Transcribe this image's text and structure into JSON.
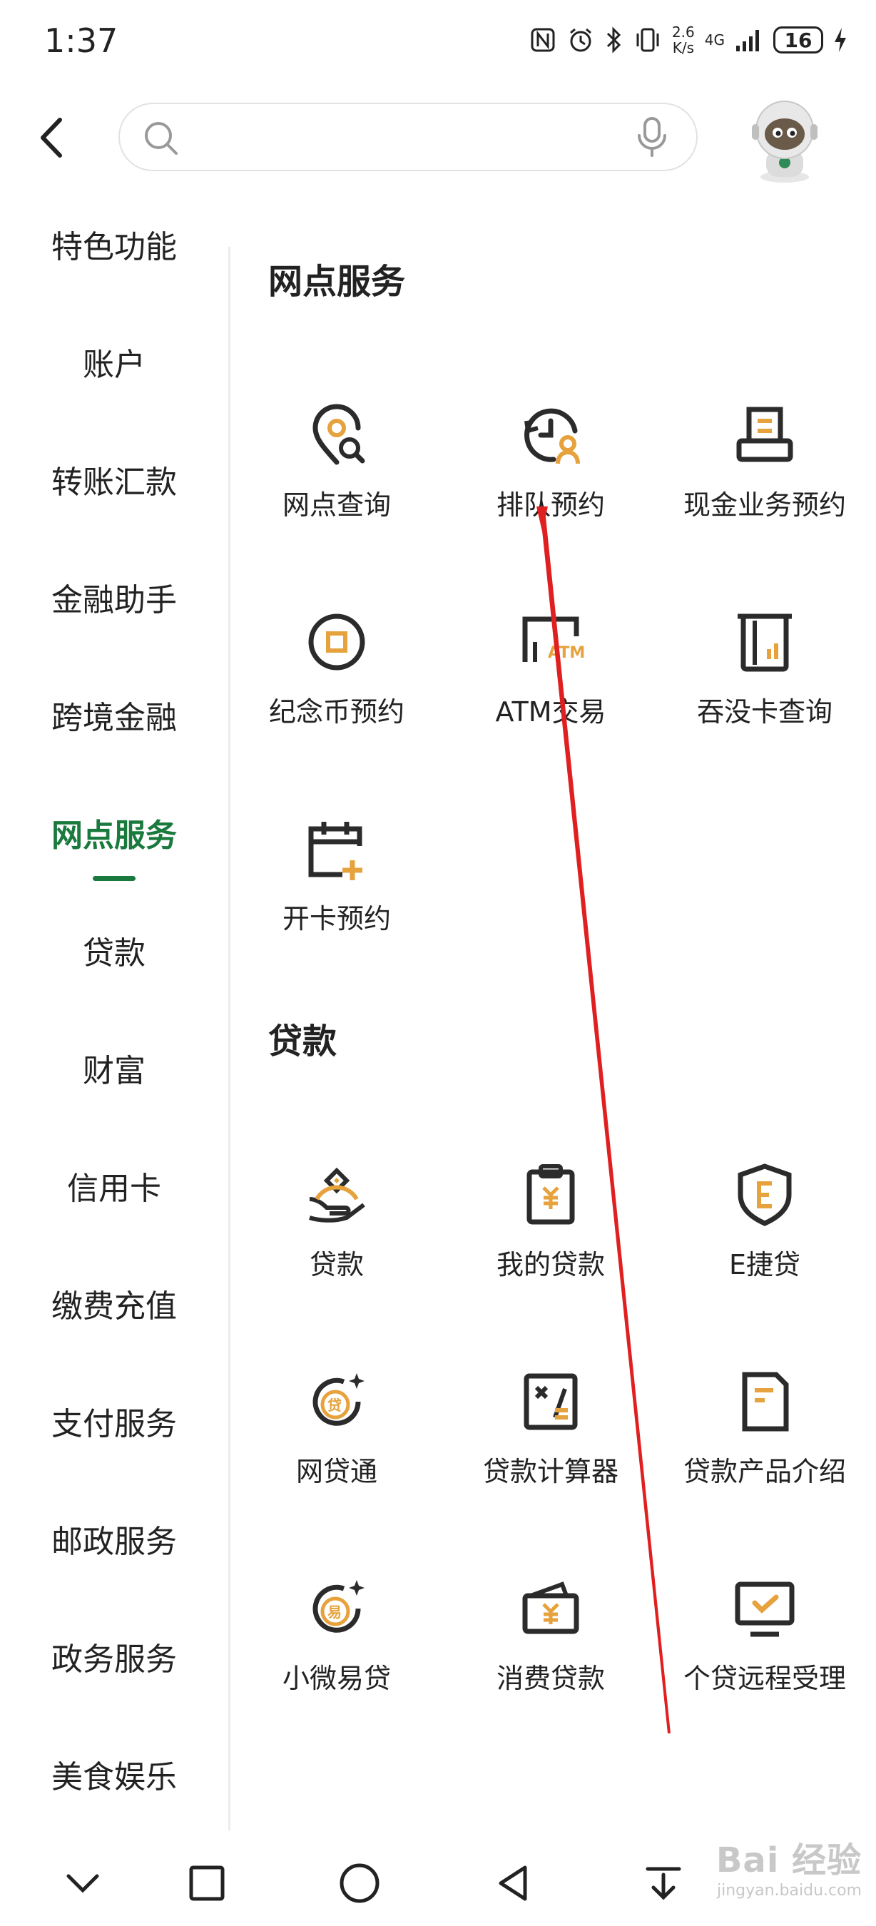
{
  "status_bar": {
    "time": "1:37",
    "speed_top": "2.6",
    "speed_bottom": "K/s",
    "network": "4G",
    "battery": "16"
  },
  "header": {
    "search_placeholder": ""
  },
  "sidebar": {
    "items": [
      {
        "label": "特色功能"
      },
      {
        "label": "账户"
      },
      {
        "label": "转账汇款"
      },
      {
        "label": "金融助手"
      },
      {
        "label": "跨境金融"
      },
      {
        "label": "网点服务",
        "active": true
      },
      {
        "label": "贷款"
      },
      {
        "label": "财富"
      },
      {
        "label": "信用卡"
      },
      {
        "label": "缴费充值"
      },
      {
        "label": "支付服务"
      },
      {
        "label": "邮政服务"
      },
      {
        "label": "政务服务"
      },
      {
        "label": "美食娱乐"
      }
    ]
  },
  "sections": [
    {
      "title": "网点服务",
      "items": [
        {
          "label": "网点查询",
          "icon": "location-search-icon"
        },
        {
          "label": "排队预约",
          "icon": "queue-clock-icon"
        },
        {
          "label": "现金业务预约",
          "icon": "cash-receipt-icon"
        },
        {
          "label": "纪念币预约",
          "icon": "commemorative-coin-icon"
        },
        {
          "label": "ATM交易",
          "icon": "atm-icon"
        },
        {
          "label": "吞没卡查询",
          "icon": "card-machine-icon"
        },
        {
          "label": "开卡预约",
          "icon": "calendar-add-icon"
        }
      ]
    },
    {
      "title": "贷款",
      "items": [
        {
          "label": "贷款",
          "icon": "hand-coin-icon"
        },
        {
          "label": "我的贷款",
          "icon": "clipboard-yuan-icon"
        },
        {
          "label": "E捷贷",
          "icon": "shield-e-icon"
        },
        {
          "label": "网贷通",
          "icon": "loan-sparkle-icon"
        },
        {
          "label": "贷款计算器",
          "icon": "calculator-icon"
        },
        {
          "label": "贷款产品介绍",
          "icon": "document-icon"
        },
        {
          "label": "小微易贷",
          "icon": "easy-loan-icon"
        },
        {
          "label": "消费贷款",
          "icon": "wallet-yuan-icon"
        },
        {
          "label": "个贷远程受理",
          "icon": "monitor-check-icon"
        }
      ]
    }
  ],
  "watermark": {
    "line1": "Bai 经验",
    "line2": "jingyan.baidu.com"
  },
  "colors": {
    "accent_green": "#1a7a3e",
    "icon_dark": "#2b2b2b",
    "icon_orange": "#e6a23c",
    "annotation_red": "#e02020"
  }
}
